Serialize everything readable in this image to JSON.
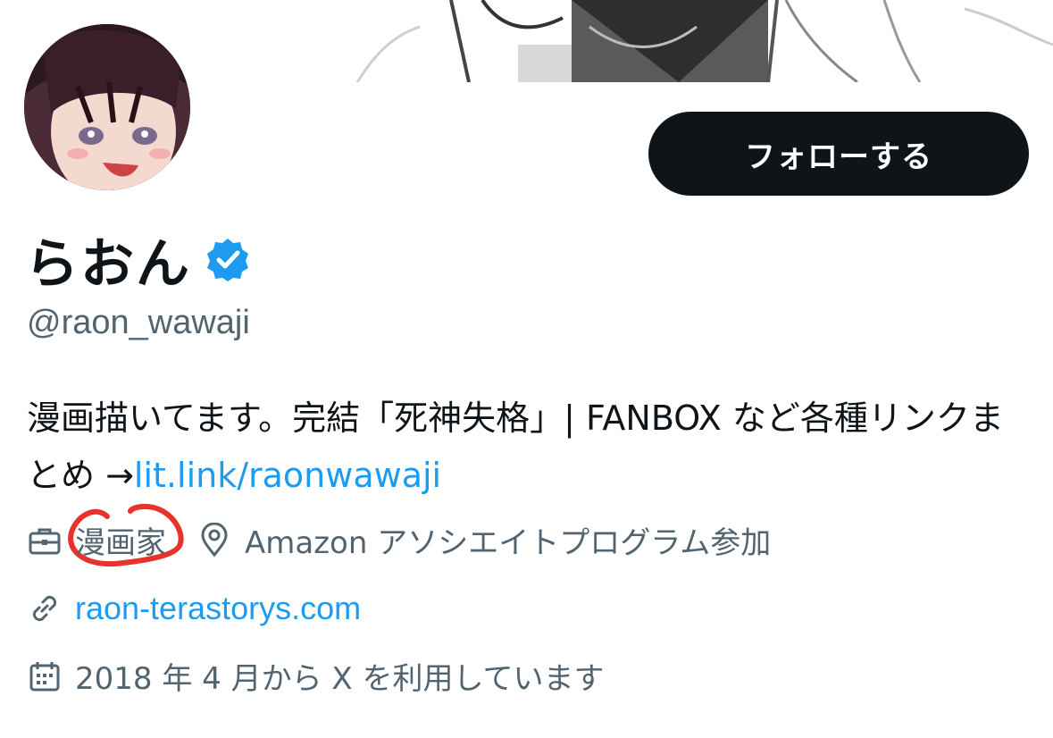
{
  "profile": {
    "display_name": "らおん",
    "handle": "@raon_wawaji",
    "follow_label": "フォローする",
    "bio_text": "漫画描いてます。完結「死神失格」| FANBOX など各種リンクまとめ →",
    "bio_link": "lit.link/raonwawaji",
    "profession": "漫画家",
    "location": "Amazon アソシエイトプログラム参加",
    "website": "raon-terastorys.com",
    "joined": "2018 年 4 月から X を利用しています"
  },
  "icons": {
    "verified": "verified-badge-icon",
    "profession": "briefcase-icon",
    "location": "map-pin-icon",
    "website": "link-icon",
    "joined": "calendar-icon"
  },
  "colors": {
    "accent": "#1d9bf0",
    "text_primary": "#0f1419",
    "text_secondary": "#536471",
    "button_bg": "#0f1419",
    "annotation_red": "#e8322b"
  }
}
